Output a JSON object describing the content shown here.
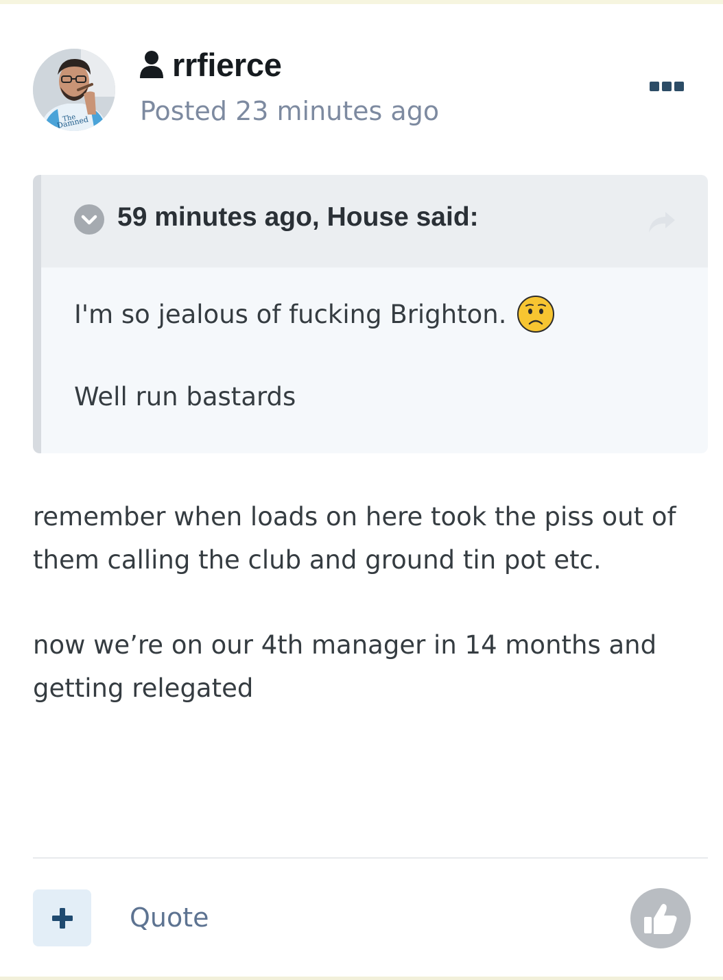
{
  "post": {
    "author": "rrfierce",
    "timestamp": "Posted 23 minutes ago",
    "avatar_icon": "user-avatar-photo",
    "author_icon": "person-icon",
    "menu_icon": "ellipsis-icon"
  },
  "quote": {
    "citation": "59 minutes ago, House said:",
    "lines": [
      "I'm so jealous of fucking Brighton.",
      "Well run bastards"
    ],
    "emoji": "worried-face-emoji",
    "toggle_icon": "chevron-down-icon",
    "share_icon": "share-arrow-icon"
  },
  "body": {
    "lines": [
      "remember when loads on here took the piss out of",
      "them calling the club and ground tin pot etc.",
      "now we’re on our 4th manager in 14 months and",
      "getting relegated"
    ]
  },
  "footer": {
    "add_icon": "plus-icon",
    "quote_label": "Quote",
    "like_icon": "thumbs-up-icon"
  },
  "colors": {
    "accent": "#2c4c66",
    "muted_text": "#7d8aa0",
    "quote_background": "#f5f8fb",
    "quote_header": "#ebeef1"
  }
}
